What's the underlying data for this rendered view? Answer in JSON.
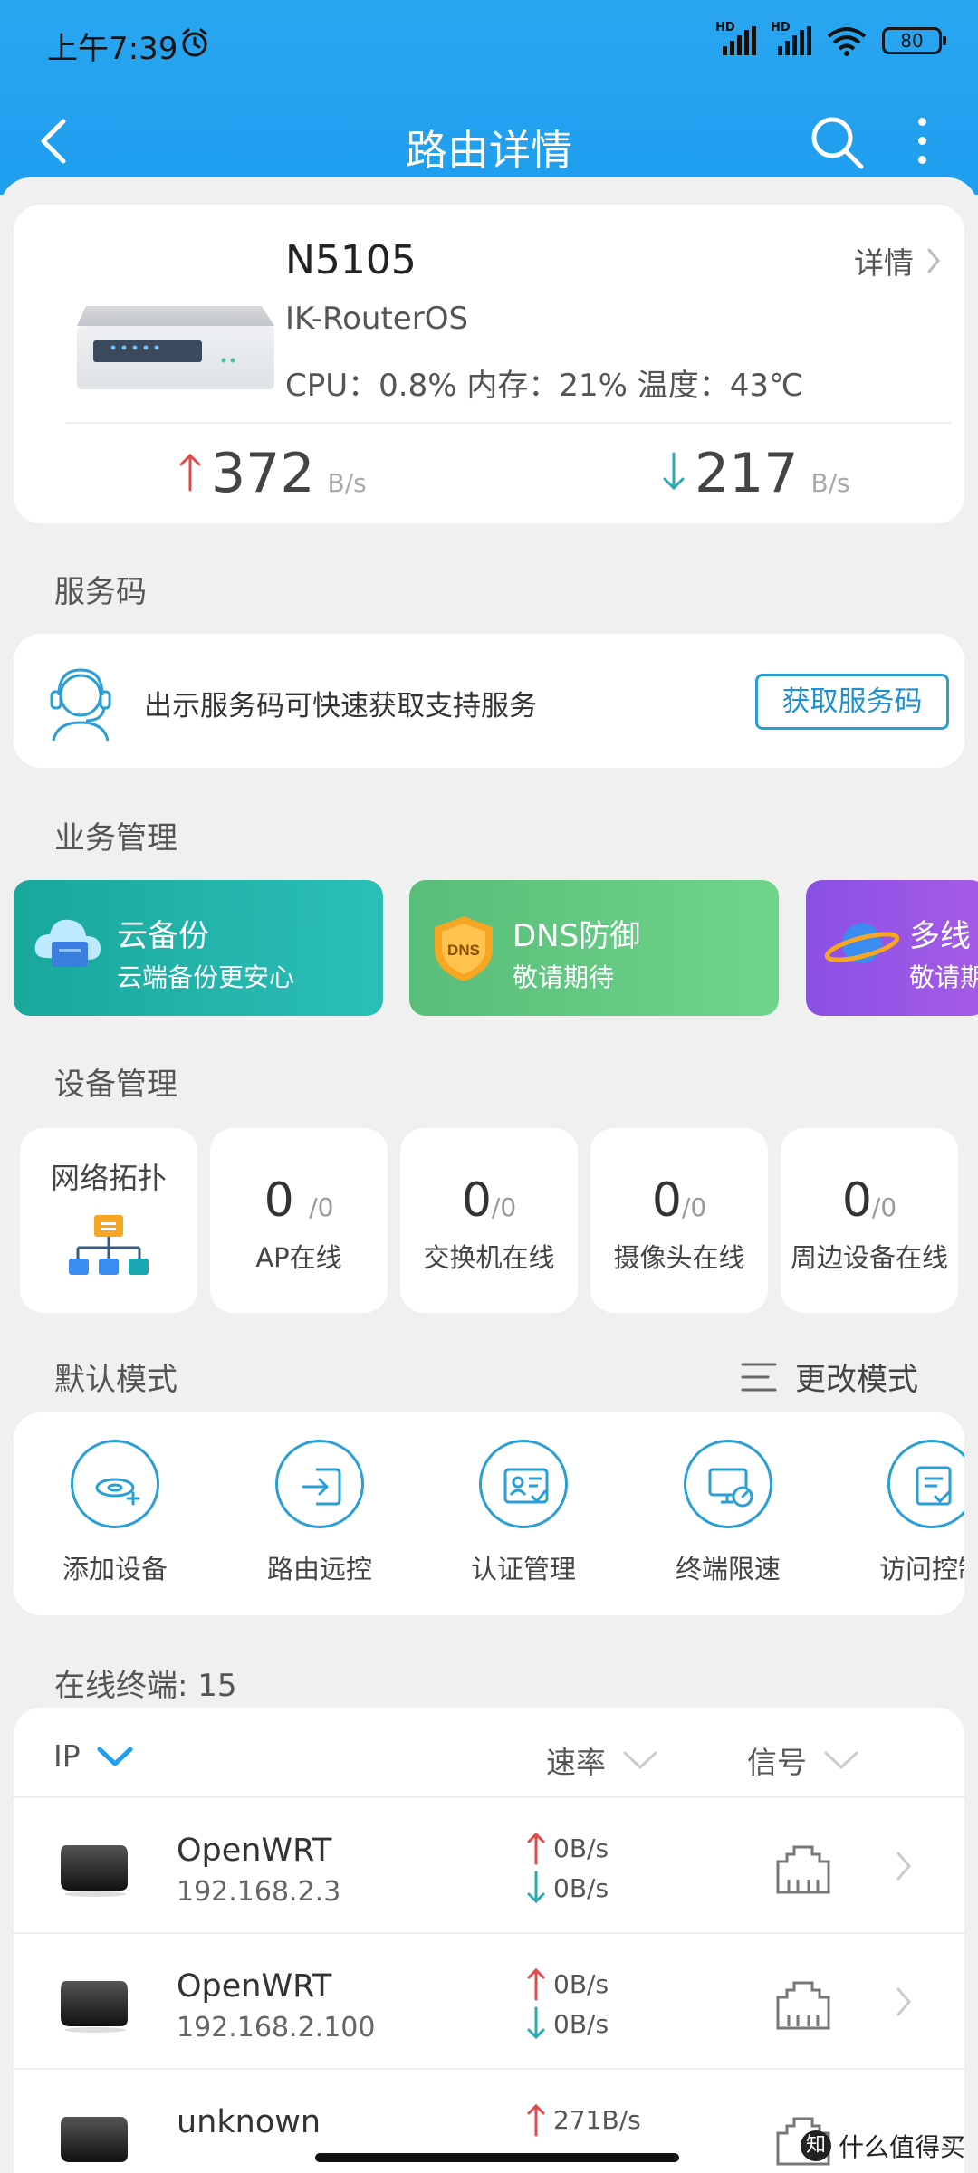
{
  "status_bar": {
    "time": "上午7:39",
    "sim1": "HD",
    "sim2": "HD",
    "battery": "80"
  },
  "nav": {
    "title": "路由详情",
    "icons": [
      "back-icon",
      "search-icon",
      "more-vertical-icon"
    ]
  },
  "router": {
    "name": "N5105",
    "detail_label": "详情",
    "os": "IK-RouterOS",
    "stats": "CPU：0.8%  内存：21%  温度：43℃",
    "upload": "372",
    "upload_unit": "B/s",
    "download": "217",
    "download_unit": "B/s"
  },
  "service": {
    "section_title": "服务码",
    "text": "出示服务码可快速获取支持服务",
    "button": "获取服务码"
  },
  "business": {
    "section_title": "业务管理",
    "cards": [
      {
        "title": "云备份",
        "subtitle": "云端备份更安心"
      },
      {
        "title": "DNS防御",
        "subtitle": "敬请期待",
        "badge": "DNS"
      },
      {
        "title": "多线",
        "subtitle": "敬请期"
      }
    ]
  },
  "devices": {
    "section_title": "设备管理",
    "topology": "网络拓扑",
    "items": [
      {
        "count": "0",
        "total": "/0",
        "label": "AP在线"
      },
      {
        "count": "0",
        "total": "/0",
        "label": "交换机在线"
      },
      {
        "count": "0",
        "total": "/0",
        "label": "摄像头在线"
      },
      {
        "count": "0",
        "total": "/0",
        "label": "周边设备在线"
      }
    ]
  },
  "mode": {
    "section_title": "默认模式",
    "change_label": "更改模式",
    "items": [
      {
        "label": "添加设备"
      },
      {
        "label": "路由远控"
      },
      {
        "label": "认证管理"
      },
      {
        "label": "终端限速"
      },
      {
        "label": "访问控制"
      }
    ]
  },
  "terminals": {
    "section_title": "在线终端: 15",
    "headers": {
      "ip": "IP",
      "rate": "速率",
      "signal": "信号"
    },
    "rows": [
      {
        "name": "OpenWRT",
        "ip": "192.168.2.3",
        "up": "0B/s",
        "down": "0B/s"
      },
      {
        "name": "OpenWRT",
        "ip": "192.168.2.100",
        "up": "0B/s",
        "down": "0B/s"
      },
      {
        "name": "unknown",
        "ip": "",
        "up": "271B/s",
        "down": ""
      }
    ]
  },
  "watermark": {
    "logo": "知",
    "text": "什么值得买"
  },
  "colors": {
    "header_blue": "#1f9eef",
    "accent_blue": "#2a9fd6",
    "upload_red": "#e04a4a",
    "download_teal": "#2aaab0",
    "background": "#f0f0f0"
  }
}
